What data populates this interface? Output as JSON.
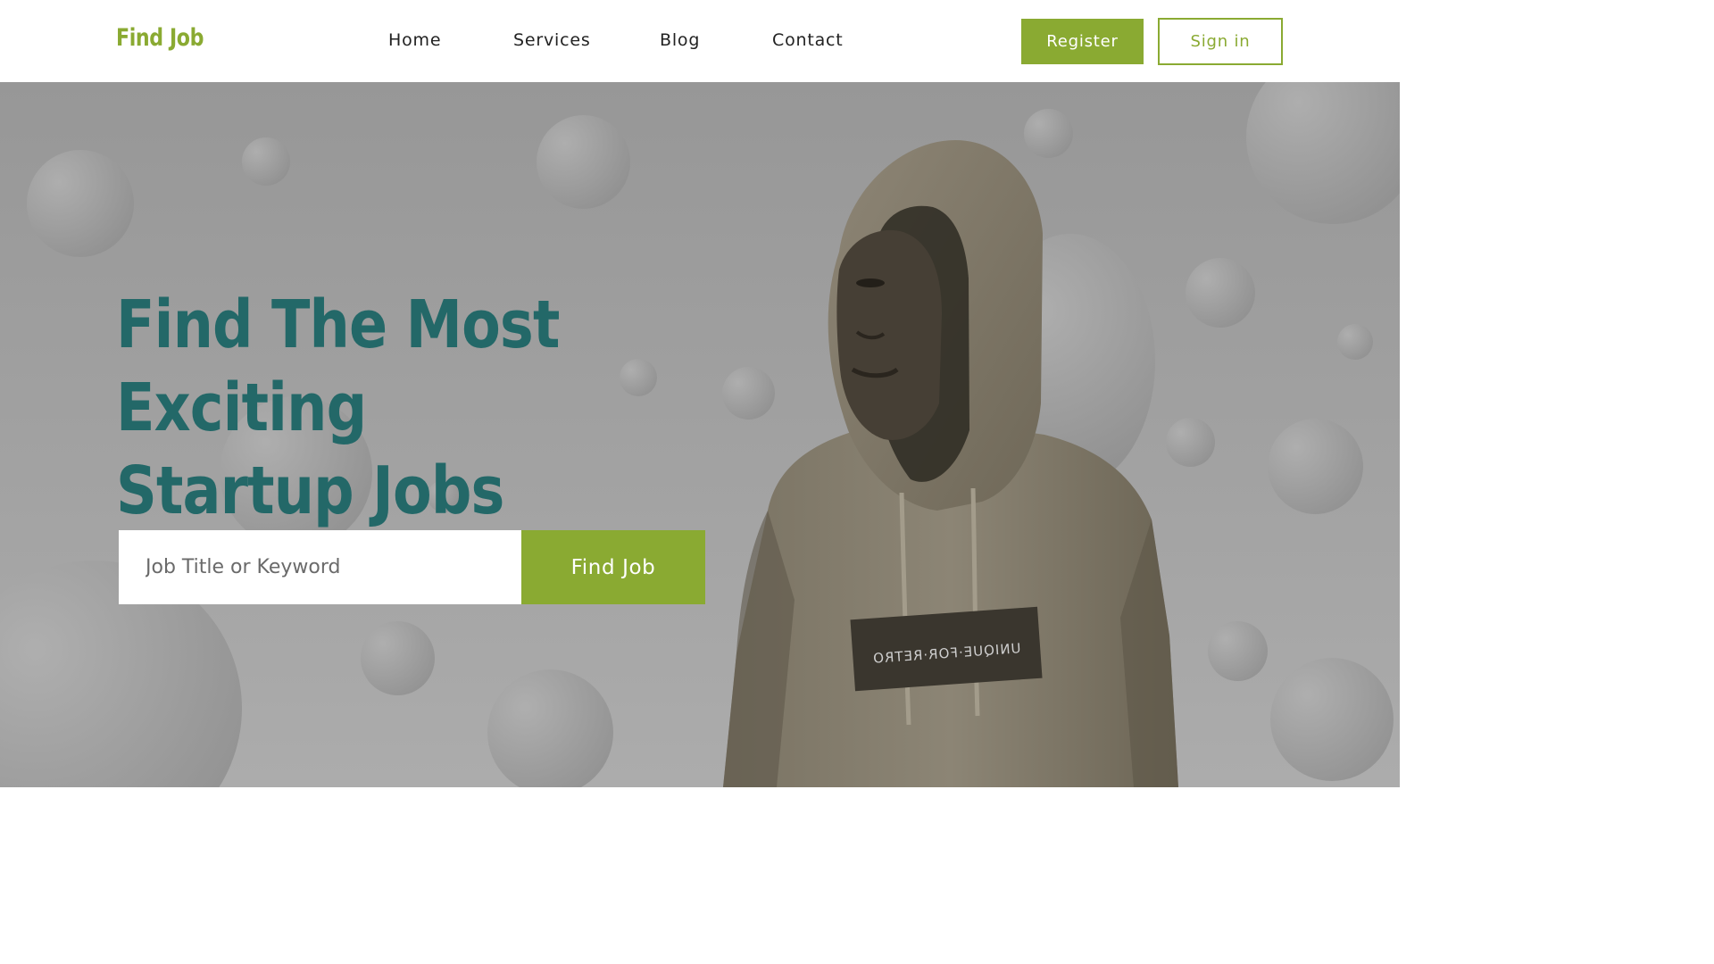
{
  "header": {
    "logo": "Find Job",
    "nav": [
      "Home",
      "Services",
      "Blog",
      "Contact"
    ],
    "register_label": "Register",
    "signin_label": "Sign in"
  },
  "hero": {
    "headline_line1": "Find The Most Exciting",
    "headline_line2": "Startup Jobs",
    "search_placeholder": "Job Title or Keyword",
    "find_button": "Find Job",
    "shirt_print": "UNIQUE·FOR·RETRO"
  },
  "colors": {
    "accent": "#8aaa32",
    "headline": "#236868",
    "hero_background": "#9e9e9e"
  },
  "icons": [
    "person-photo"
  ]
}
